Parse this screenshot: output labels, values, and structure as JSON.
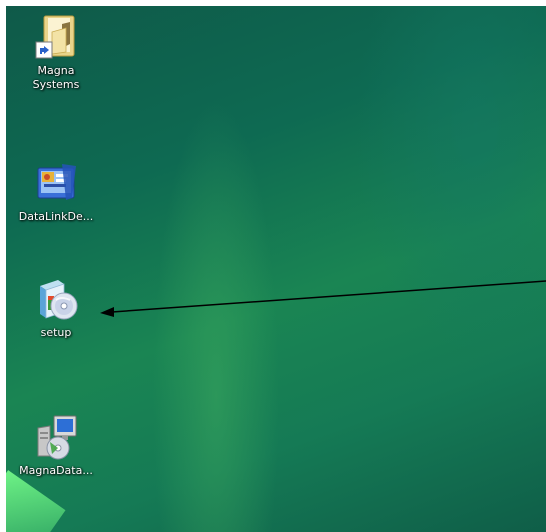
{
  "desktop": {
    "icons": [
      {
        "label": "Magna\nSystems",
        "icon": "folder-shortcut-icon"
      },
      {
        "label": "DataLinkDe...",
        "icon": "datalink-app-icon"
      },
      {
        "label": "setup",
        "icon": "setup-installer-icon"
      },
      {
        "label": "MagnaData...",
        "icon": "magnadata-installer-icon"
      }
    ]
  },
  "annotation": {
    "arrow_target": "setup",
    "arrow_color": "#000000"
  },
  "colors": {
    "wallpaper_dark": "#0f5a49",
    "wallpaper_light": "#1a8553",
    "label_text": "#ffffff"
  }
}
